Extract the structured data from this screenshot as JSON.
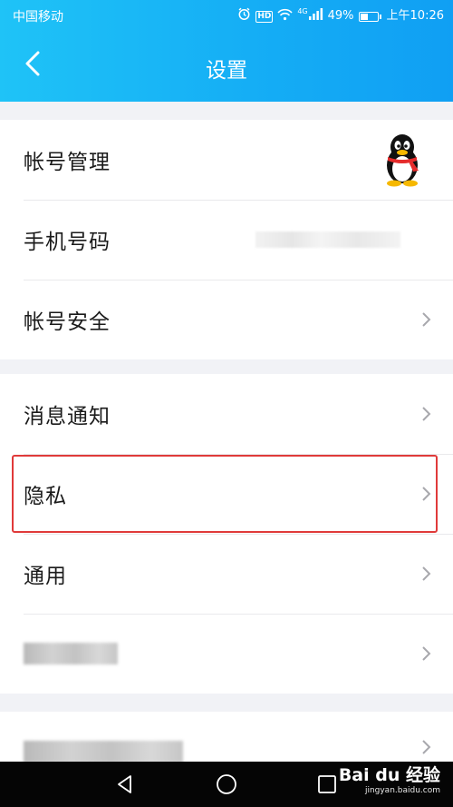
{
  "status_bar": {
    "carrier": "中国移动",
    "network": "4G",
    "hd": "HD",
    "battery": "49%",
    "battery_level": 0.49,
    "time": "上午10:26"
  },
  "header": {
    "title": "设置"
  },
  "groups": [
    {
      "items": [
        {
          "label": "帐号管理",
          "trailing": "qq-penguin-avatar"
        },
        {
          "label": "手机号码",
          "trailing": "blurred-value"
        },
        {
          "label": "帐号安全",
          "trailing": "chevron"
        }
      ]
    },
    {
      "items": [
        {
          "label": "消息通知",
          "trailing": "chevron"
        },
        {
          "label": "隐私",
          "trailing": "chevron",
          "highlighted": true
        },
        {
          "label": "通用",
          "trailing": "chevron"
        },
        {
          "label": "",
          "trailing": "chevron",
          "blurred": true
        }
      ]
    },
    {
      "items": [
        {
          "label": "",
          "trailing": "chevron",
          "blurred": true
        }
      ]
    }
  ],
  "watermark": {
    "main": "Bai du 经验",
    "sub": "jingyan.baidu.com"
  },
  "colors": {
    "header_gradient_start": "#1fc3f7",
    "header_gradient_end": "#109ff3",
    "highlight_border": "#e03a3a",
    "page_background": "#f1f2f6"
  }
}
